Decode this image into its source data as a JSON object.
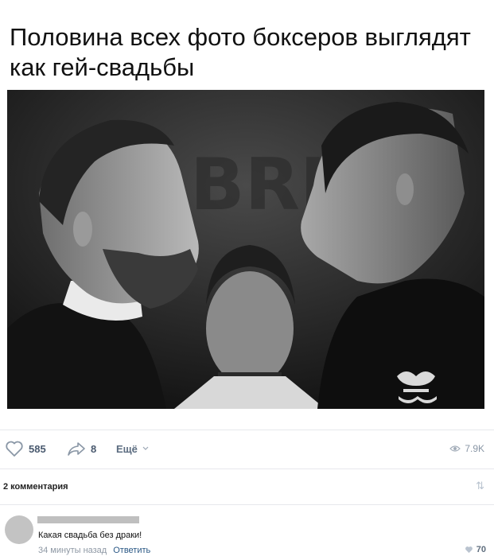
{
  "post": {
    "title": "Половина всех фото боксеров выглядят как гей-свадьбы",
    "image_icon": "photo-of-two-boxers-face-off"
  },
  "actions": {
    "likes": "585",
    "shares": "8",
    "more_label": "Ещё",
    "views": "7.9K"
  },
  "comments": {
    "count_label": "2 комментария",
    "items": [
      {
        "text": "Какая свадьба без драки!",
        "time": "34 минуты назад",
        "reply_label": "Ответить",
        "likes": "70"
      }
    ]
  },
  "colors": {
    "link": "#2a5885",
    "action_text": "#4a5a6f",
    "muted": "#8e98a4",
    "divider": "#e7e8ec"
  }
}
